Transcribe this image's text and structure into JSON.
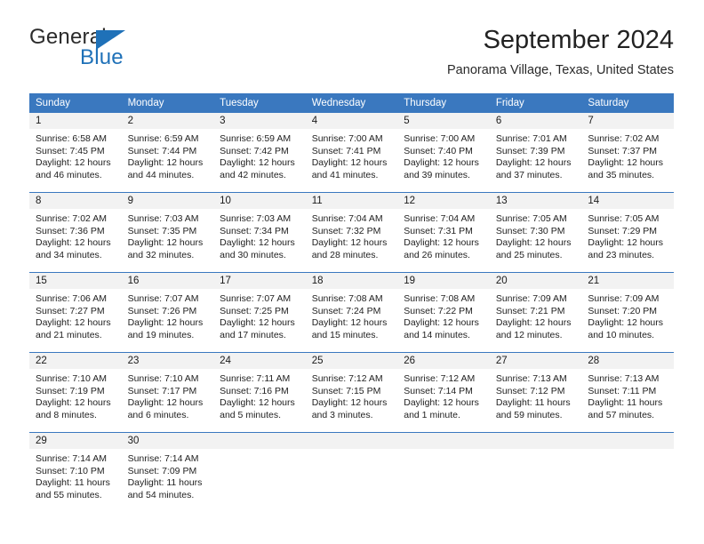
{
  "brand": {
    "word_one": "General",
    "word_two": "Blue",
    "flag_icon": "triangle-flag-icon",
    "color_blue": "#1f71b8",
    "color_dark": "#2b2b2b"
  },
  "header": {
    "month_title": "September 2024",
    "location": "Panorama Village, Texas, United States"
  },
  "theme": {
    "header_row_bg": "#3a78bf",
    "daynum_band_bg": "#f2f2f2",
    "grid_line": "#3a78bf",
    "page_bg": "#ffffff"
  },
  "weekday_headers": [
    "Sunday",
    "Monday",
    "Tuesday",
    "Wednesday",
    "Thursday",
    "Friday",
    "Saturday"
  ],
  "weeks": [
    [
      {
        "day": "1",
        "sunrise": "Sunrise: 6:58 AM",
        "sunset": "Sunset: 7:45 PM",
        "daylight_1": "Daylight: 12 hours",
        "daylight_2": "and 46 minutes."
      },
      {
        "day": "2",
        "sunrise": "Sunrise: 6:59 AM",
        "sunset": "Sunset: 7:44 PM",
        "daylight_1": "Daylight: 12 hours",
        "daylight_2": "and 44 minutes."
      },
      {
        "day": "3",
        "sunrise": "Sunrise: 6:59 AM",
        "sunset": "Sunset: 7:42 PM",
        "daylight_1": "Daylight: 12 hours",
        "daylight_2": "and 42 minutes."
      },
      {
        "day": "4",
        "sunrise": "Sunrise: 7:00 AM",
        "sunset": "Sunset: 7:41 PM",
        "daylight_1": "Daylight: 12 hours",
        "daylight_2": "and 41 minutes."
      },
      {
        "day": "5",
        "sunrise": "Sunrise: 7:00 AM",
        "sunset": "Sunset: 7:40 PM",
        "daylight_1": "Daylight: 12 hours",
        "daylight_2": "and 39 minutes."
      },
      {
        "day": "6",
        "sunrise": "Sunrise: 7:01 AM",
        "sunset": "Sunset: 7:39 PM",
        "daylight_1": "Daylight: 12 hours",
        "daylight_2": "and 37 minutes."
      },
      {
        "day": "7",
        "sunrise": "Sunrise: 7:02 AM",
        "sunset": "Sunset: 7:37 PM",
        "daylight_1": "Daylight: 12 hours",
        "daylight_2": "and 35 minutes."
      }
    ],
    [
      {
        "day": "8",
        "sunrise": "Sunrise: 7:02 AM",
        "sunset": "Sunset: 7:36 PM",
        "daylight_1": "Daylight: 12 hours",
        "daylight_2": "and 34 minutes."
      },
      {
        "day": "9",
        "sunrise": "Sunrise: 7:03 AM",
        "sunset": "Sunset: 7:35 PM",
        "daylight_1": "Daylight: 12 hours",
        "daylight_2": "and 32 minutes."
      },
      {
        "day": "10",
        "sunrise": "Sunrise: 7:03 AM",
        "sunset": "Sunset: 7:34 PM",
        "daylight_1": "Daylight: 12 hours",
        "daylight_2": "and 30 minutes."
      },
      {
        "day": "11",
        "sunrise": "Sunrise: 7:04 AM",
        "sunset": "Sunset: 7:32 PM",
        "daylight_1": "Daylight: 12 hours",
        "daylight_2": "and 28 minutes."
      },
      {
        "day": "12",
        "sunrise": "Sunrise: 7:04 AM",
        "sunset": "Sunset: 7:31 PM",
        "daylight_1": "Daylight: 12 hours",
        "daylight_2": "and 26 minutes."
      },
      {
        "day": "13",
        "sunrise": "Sunrise: 7:05 AM",
        "sunset": "Sunset: 7:30 PM",
        "daylight_1": "Daylight: 12 hours",
        "daylight_2": "and 25 minutes."
      },
      {
        "day": "14",
        "sunrise": "Sunrise: 7:05 AM",
        "sunset": "Sunset: 7:29 PM",
        "daylight_1": "Daylight: 12 hours",
        "daylight_2": "and 23 minutes."
      }
    ],
    [
      {
        "day": "15",
        "sunrise": "Sunrise: 7:06 AM",
        "sunset": "Sunset: 7:27 PM",
        "daylight_1": "Daylight: 12 hours",
        "daylight_2": "and 21 minutes."
      },
      {
        "day": "16",
        "sunrise": "Sunrise: 7:07 AM",
        "sunset": "Sunset: 7:26 PM",
        "daylight_1": "Daylight: 12 hours",
        "daylight_2": "and 19 minutes."
      },
      {
        "day": "17",
        "sunrise": "Sunrise: 7:07 AM",
        "sunset": "Sunset: 7:25 PM",
        "daylight_1": "Daylight: 12 hours",
        "daylight_2": "and 17 minutes."
      },
      {
        "day": "18",
        "sunrise": "Sunrise: 7:08 AM",
        "sunset": "Sunset: 7:24 PM",
        "daylight_1": "Daylight: 12 hours",
        "daylight_2": "and 15 minutes."
      },
      {
        "day": "19",
        "sunrise": "Sunrise: 7:08 AM",
        "sunset": "Sunset: 7:22 PM",
        "daylight_1": "Daylight: 12 hours",
        "daylight_2": "and 14 minutes."
      },
      {
        "day": "20",
        "sunrise": "Sunrise: 7:09 AM",
        "sunset": "Sunset: 7:21 PM",
        "daylight_1": "Daylight: 12 hours",
        "daylight_2": "and 12 minutes."
      },
      {
        "day": "21",
        "sunrise": "Sunrise: 7:09 AM",
        "sunset": "Sunset: 7:20 PM",
        "daylight_1": "Daylight: 12 hours",
        "daylight_2": "and 10 minutes."
      }
    ],
    [
      {
        "day": "22",
        "sunrise": "Sunrise: 7:10 AM",
        "sunset": "Sunset: 7:19 PM",
        "daylight_1": "Daylight: 12 hours",
        "daylight_2": "and 8 minutes."
      },
      {
        "day": "23",
        "sunrise": "Sunrise: 7:10 AM",
        "sunset": "Sunset: 7:17 PM",
        "daylight_1": "Daylight: 12 hours",
        "daylight_2": "and 6 minutes."
      },
      {
        "day": "24",
        "sunrise": "Sunrise: 7:11 AM",
        "sunset": "Sunset: 7:16 PM",
        "daylight_1": "Daylight: 12 hours",
        "daylight_2": "and 5 minutes."
      },
      {
        "day": "25",
        "sunrise": "Sunrise: 7:12 AM",
        "sunset": "Sunset: 7:15 PM",
        "daylight_1": "Daylight: 12 hours",
        "daylight_2": "and 3 minutes."
      },
      {
        "day": "26",
        "sunrise": "Sunrise: 7:12 AM",
        "sunset": "Sunset: 7:14 PM",
        "daylight_1": "Daylight: 12 hours",
        "daylight_2": "and 1 minute."
      },
      {
        "day": "27",
        "sunrise": "Sunrise: 7:13 AM",
        "sunset": "Sunset: 7:12 PM",
        "daylight_1": "Daylight: 11 hours",
        "daylight_2": "and 59 minutes."
      },
      {
        "day": "28",
        "sunrise": "Sunrise: 7:13 AM",
        "sunset": "Sunset: 7:11 PM",
        "daylight_1": "Daylight: 11 hours",
        "daylight_2": "and 57 minutes."
      }
    ],
    [
      {
        "day": "29",
        "sunrise": "Sunrise: 7:14 AM",
        "sunset": "Sunset: 7:10 PM",
        "daylight_1": "Daylight: 11 hours",
        "daylight_2": "and 55 minutes."
      },
      {
        "day": "30",
        "sunrise": "Sunrise: 7:14 AM",
        "sunset": "Sunset: 7:09 PM",
        "daylight_1": "Daylight: 11 hours",
        "daylight_2": "and 54 minutes."
      },
      {
        "day": "",
        "sunrise": "",
        "sunset": "",
        "daylight_1": "",
        "daylight_2": ""
      },
      {
        "day": "",
        "sunrise": "",
        "sunset": "",
        "daylight_1": "",
        "daylight_2": ""
      },
      {
        "day": "",
        "sunrise": "",
        "sunset": "",
        "daylight_1": "",
        "daylight_2": ""
      },
      {
        "day": "",
        "sunrise": "",
        "sunset": "",
        "daylight_1": "",
        "daylight_2": ""
      },
      {
        "day": "",
        "sunrise": "",
        "sunset": "",
        "daylight_1": "",
        "daylight_2": ""
      }
    ]
  ]
}
